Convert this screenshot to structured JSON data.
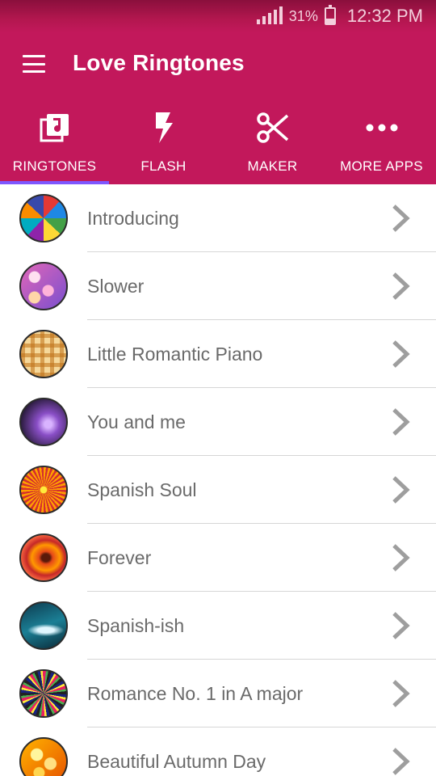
{
  "status_bar": {
    "battery_percent": "31%",
    "time": "12:32 PM",
    "battery_level": 0.31
  },
  "app_bar": {
    "title": "Love Ringtones",
    "menu_icon": "hamburger-menu-icon"
  },
  "tabs": [
    {
      "label": "RINGTONES",
      "icon": "music-library-icon",
      "active": true
    },
    {
      "label": "FLASH",
      "icon": "flash-icon",
      "active": false
    },
    {
      "label": "MAKER",
      "icon": "scissors-icon",
      "active": false
    },
    {
      "label": "MORE APPS",
      "icon": "more-dots-icon",
      "active": false
    }
  ],
  "ringtones": [
    {
      "title": "Introducing",
      "thumb": "thumb-mosaic"
    },
    {
      "title": "Slower",
      "thumb": "thumb-bokeh"
    },
    {
      "title": "Little Romantic Piano",
      "thumb": "thumb-plaid"
    },
    {
      "title": "You and me",
      "thumb": "thumb-purple-glow"
    },
    {
      "title": "Spanish Soul",
      "thumb": "thumb-sunburst"
    },
    {
      "title": "Forever",
      "thumb": "thumb-orange-rings"
    },
    {
      "title": "Spanish-ish",
      "thumb": "thumb-teal-wave"
    },
    {
      "title": "Romance No. 1 in A major",
      "thumb": "thumb-colorful-burst"
    },
    {
      "title": "Beautiful Autumn Day",
      "thumb": "thumb-golden-bokeh"
    }
  ],
  "colors": {
    "primary": "#c2185b",
    "tab_indicator": "#7e57ff",
    "text_secondary": "#6a6a6a",
    "chevron": "#9e9e9e"
  }
}
